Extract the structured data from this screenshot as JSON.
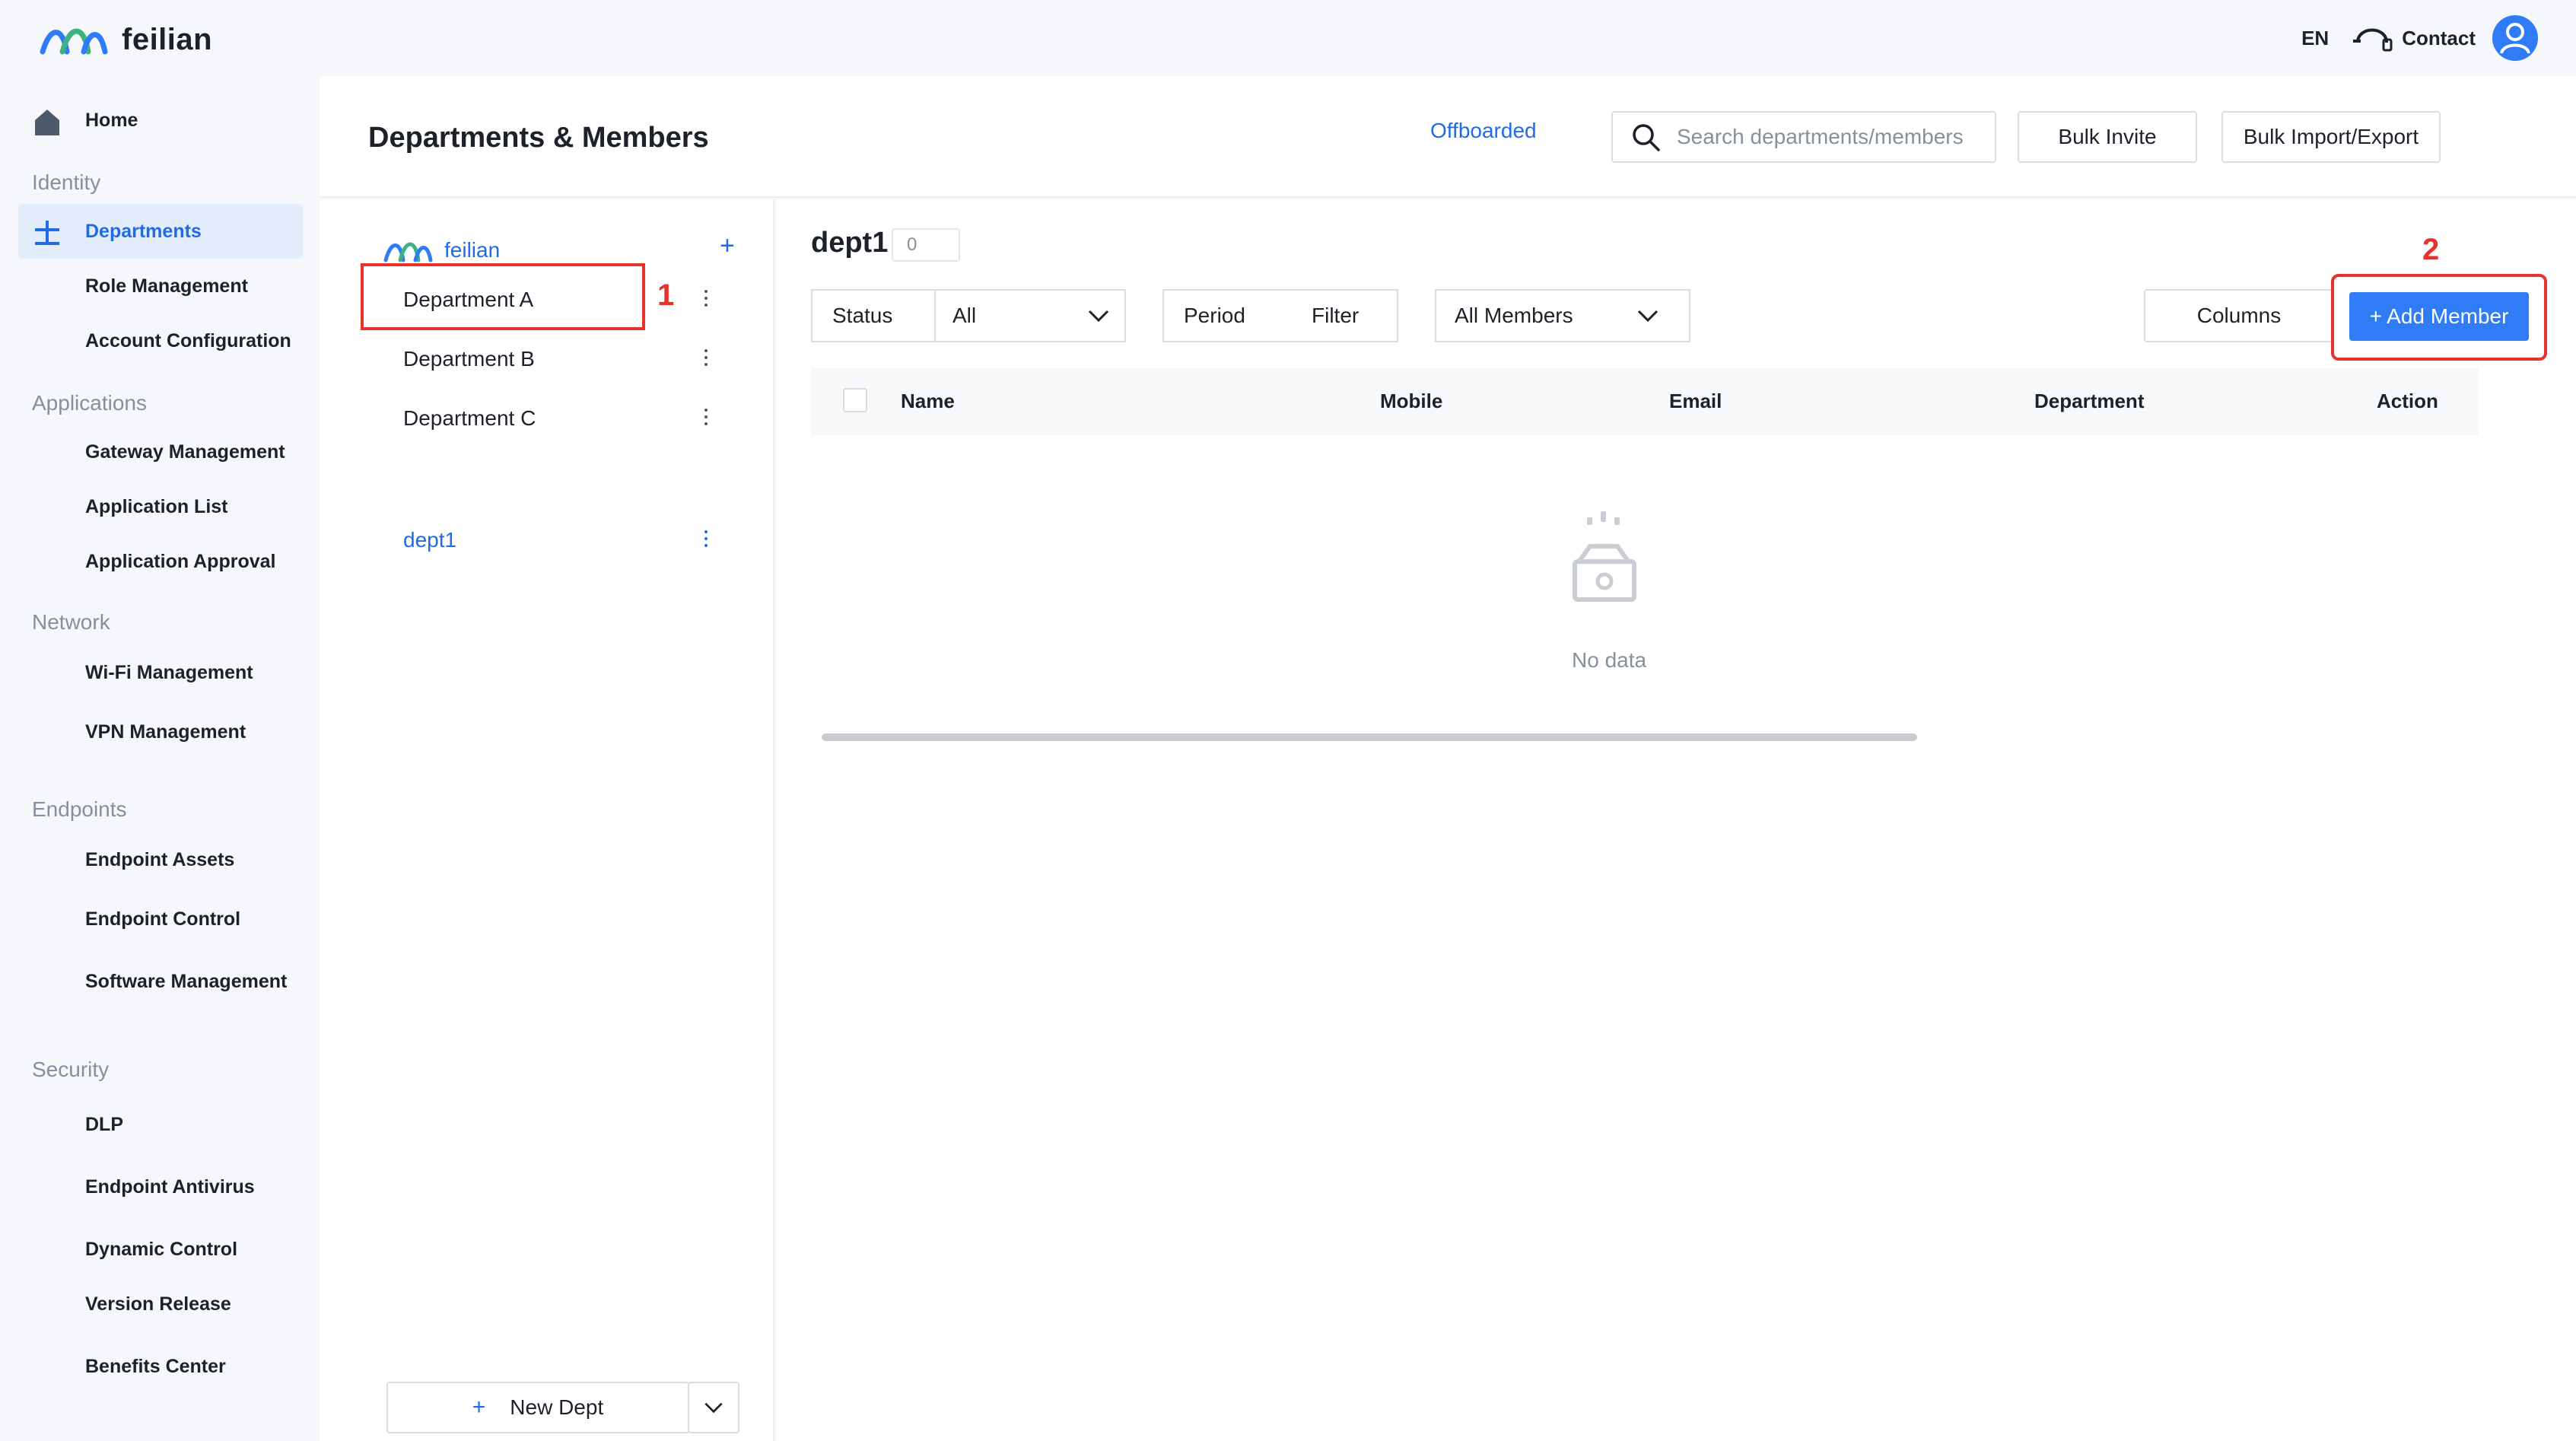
{
  "app": {
    "brand": "feilian",
    "language": "EN",
    "contact_label": "Contact"
  },
  "sidebar": {
    "home": "Home",
    "groups": {
      "identity": "Identity",
      "applications": "Applications",
      "network": "Network",
      "endpoints": "Endpoints",
      "security": "Security"
    },
    "items": {
      "departments": "Departments",
      "role_management": "Role Management",
      "account_configuration": "Account Configuration",
      "gateway_management": "Gateway Management",
      "application_list": "Application List",
      "application_approval": "Application Approval",
      "wifi_management": "Wi-Fi Management",
      "vpn_management": "VPN Management",
      "endpoint_assets": "Endpoint Assets",
      "endpoint_control": "Endpoint Control",
      "software_management": "Software Management",
      "dlp": "DLP",
      "endpoint_antivirus": "Endpoint Antivirus",
      "dynamic_control": "Dynamic Control",
      "version_release": "Version Release",
      "benefits_center": "Benefits Center"
    },
    "active": "departments"
  },
  "header": {
    "title": "Departments & Members",
    "offboarded_link": "Offboarded",
    "search_placeholder": "Search departments/members",
    "bulk_invite": "Bulk Invite",
    "bulk_import_export": "Bulk Import/Export"
  },
  "tree": {
    "root": "feilian",
    "add_symbol": "+",
    "departments": [
      "Department A",
      "Department B",
      "Department C",
      "dept1"
    ],
    "selected": "dept1",
    "new_dept_label": "New Dept"
  },
  "content": {
    "dept_name": "dept1",
    "member_count": "0",
    "filters": {
      "status_label": "Status",
      "status_value": "All",
      "period_label": "Period",
      "period_value": "Filter",
      "members_value": "All Members"
    },
    "columns_button": "Columns",
    "add_member_button": "+ Add Member",
    "table_columns": [
      "Name",
      "Mobile",
      "Email",
      "Department",
      "Action"
    ],
    "empty_text": "No data"
  },
  "annotations": [
    "1",
    "2"
  ],
  "colors": {
    "accent": "#2f7cf6",
    "link": "#1f6be8",
    "annotation": "#e5322d",
    "sidebar_bg": "#f5f7fa"
  }
}
